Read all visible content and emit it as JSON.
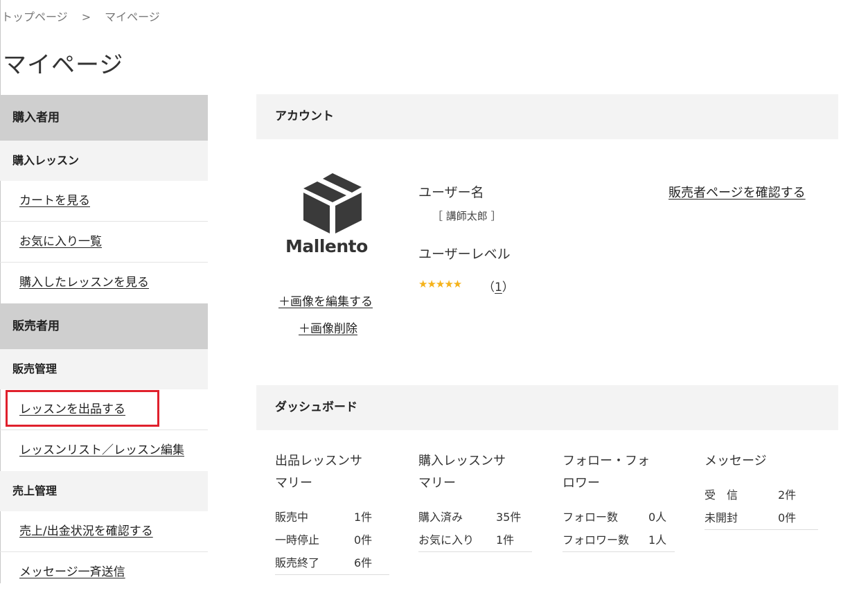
{
  "breadcrumb": {
    "home": "トップページ",
    "separator": ">",
    "current": "マイページ"
  },
  "page_title": "マイページ",
  "sidebar": {
    "buyer_header": "購入者用",
    "buyer_sub": "購入レッスン",
    "buyer_links": [
      "カートを見る",
      "お気に入り一覧",
      "購入したレッスンを見る"
    ],
    "seller_header": "販売者用",
    "sales_mgmt": "販売管理",
    "sales_links": [
      "レッスンを出品する",
      "レッスンリスト／レッスン編集"
    ],
    "revenue_mgmt": "売上管理",
    "revenue_links": [
      "売上/出金状況を確認する",
      "メッセージ一斉送信"
    ]
  },
  "account": {
    "header": "アカウント",
    "logo_text": "Mallento",
    "edit_image": "＋画像を編集する",
    "delete_image": "＋画像削除",
    "username_label": "ユーザー名",
    "username_value": "［ 講師太郎 ］",
    "level_label": "ユーザーレベル",
    "stars": "★★★★★",
    "rating_open": "（",
    "rating_count": "1",
    "rating_close": "）",
    "rating_value": 5,
    "seller_page_link": "販売者ページを確認する"
  },
  "dashboard": {
    "header": "ダッシュボード",
    "listing": {
      "title_l1": "出品レッスンサ",
      "title_l2": "マリー",
      "rows": [
        {
          "label": "販売中",
          "value": "1件"
        },
        {
          "label": "一時停止",
          "value": "0件"
        },
        {
          "label": "販売終了",
          "value": "6件"
        }
      ]
    },
    "purchase": {
      "title_l1": "購入レッスンサ",
      "title_l2": "マリー",
      "rows": [
        {
          "label": "購入済み",
          "value": "35件"
        },
        {
          "label": "お気に入り",
          "value": "1件"
        }
      ]
    },
    "follow": {
      "title_l1": "フォロー・フォ",
      "title_l2": "ロワー",
      "rows": [
        {
          "label": "フォロー数",
          "value": "0人"
        },
        {
          "label": "フォロワー数",
          "value": "1人"
        }
      ]
    },
    "message": {
      "title_l1": "メッセージ",
      "rows": [
        {
          "label": "受　信",
          "value": "2件"
        },
        {
          "label": "未開封",
          "value": "0件"
        }
      ]
    }
  },
  "colors": {
    "highlight": "#e0202c",
    "star": "#f5b21a",
    "sidebar_header_bg": "#cfcfcf",
    "section_bg": "#f3f3f3"
  }
}
